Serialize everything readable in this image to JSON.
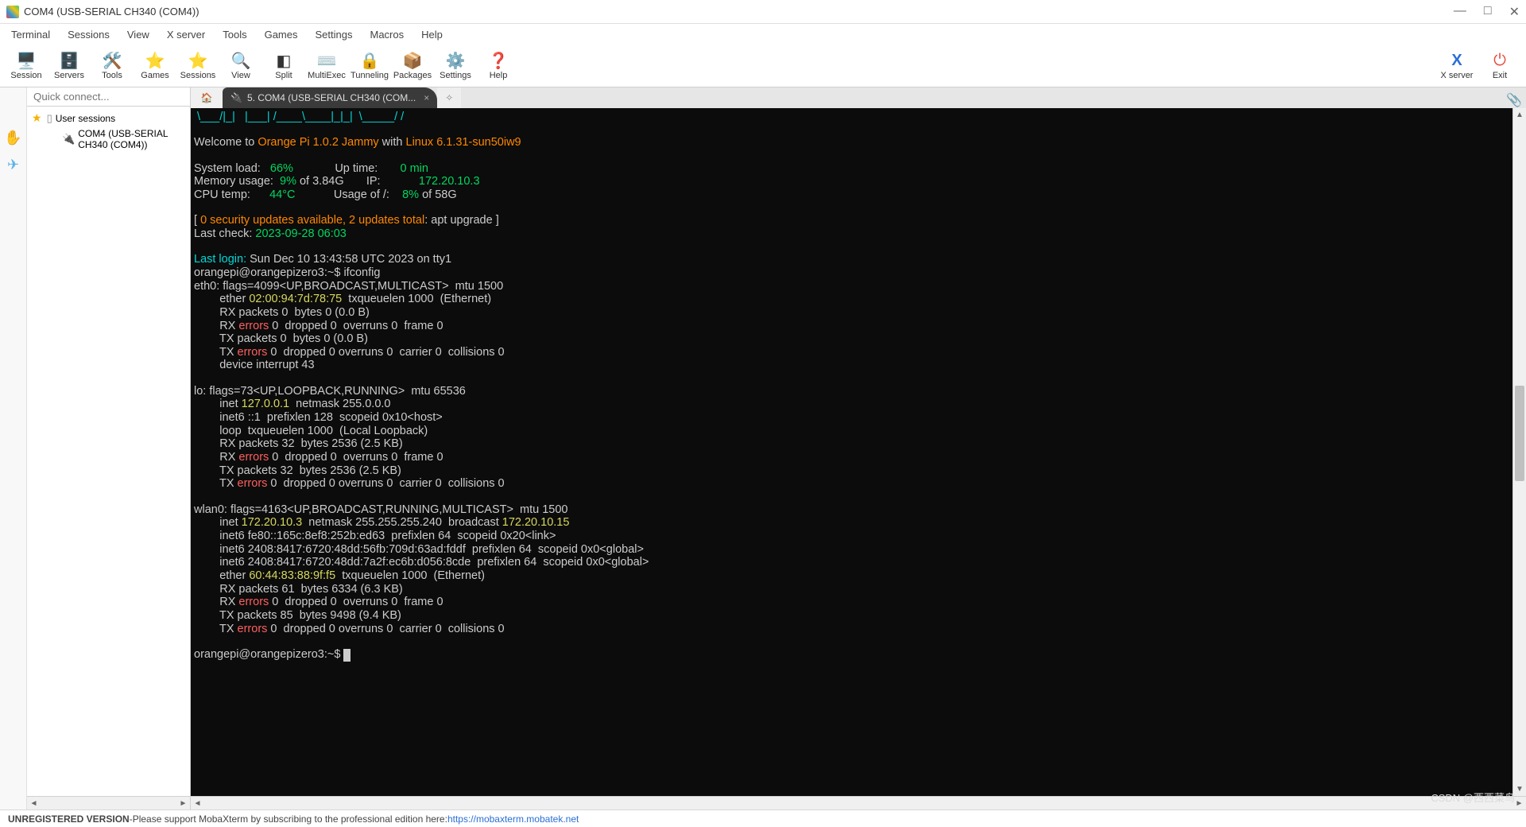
{
  "window": {
    "title": "COM4  (USB-SERIAL CH340 (COM4))",
    "controls": {
      "min": "—",
      "max": "□",
      "close": "✕"
    }
  },
  "menu": {
    "items": [
      "Terminal",
      "Sessions",
      "View",
      "X server",
      "Tools",
      "Games",
      "Settings",
      "Macros",
      "Help"
    ]
  },
  "toolbar": {
    "session": {
      "label": "Session",
      "icon": "🖥️"
    },
    "servers": {
      "label": "Servers",
      "icon": "🗄️"
    },
    "tools": {
      "label": "Tools",
      "icon": "🛠️"
    },
    "games": {
      "label": "Games",
      "icon": "⭐"
    },
    "sessions": {
      "label": "Sessions",
      "icon": "⭐"
    },
    "view": {
      "label": "View",
      "icon": "🔍"
    },
    "split": {
      "label": "Split",
      "icon": "◧"
    },
    "multiexec": {
      "label": "MultiExec",
      "icon": "⌨️"
    },
    "tunneling": {
      "label": "Tunneling",
      "icon": "🔒"
    },
    "packages": {
      "label": "Packages",
      "icon": "📦"
    },
    "settings": {
      "label": "Settings",
      "icon": "⚙️"
    },
    "help": {
      "label": "Help",
      "icon": "❓"
    },
    "xserver": {
      "label": "X server",
      "icon": "X"
    },
    "exit": {
      "label": "Exit",
      "icon": "⏻"
    }
  },
  "sidebar": {
    "quick_placeholder": "Quick connect...",
    "user_sessions": "User sessions",
    "session_item": "COM4  (USB-SERIAL CH340 (COM4))"
  },
  "tabs": {
    "home_icon": "🏠",
    "active_label": "5. COM4  (USB-SERIAL CH340 (COM...",
    "close": "×",
    "add": "✧"
  },
  "terminal": {
    "ascii1": " \\___/|_|   |___| /____\\____|_|_|  \\_____/ /",
    "welcome_pre": "Welcome to ",
    "welcome_os": "Orange Pi 1.0.2 Jammy",
    "welcome_mid": " with ",
    "welcome_kernel": "Linux 6.1.31-sun50iw9",
    "sl_label": "System load:   ",
    "sl_val": "66%",
    "mu_label": "Memory usage:  ",
    "mu_val": "9%",
    "mu_of": " of 3.84G",
    "ct_label": "CPU temp:      ",
    "ct_val": "44°C",
    "ut_label": "Up time:       ",
    "ut_val": "0 min",
    "ip_label": "IP:            ",
    "ip_val": "172.20.10.3",
    "du_label": "Usage of /:    ",
    "du_val": "8%",
    "du_of": " of 58G",
    "upd_lb": "[ ",
    "upd_pre": "0 security updates available, 2 updates total",
    "upd_post": ": apt upgrade ]",
    "lastcheck_l": "Last check: ",
    "lastcheck_v": "2023-09-28 06:03",
    "lastlogin_l": "Last login:",
    "lastlogin_v": " Sun Dec 10 13:43:58 UTC 2023 on tty1",
    "prompt1": "orangepi@orangepizero3:~$ ifconfig",
    "eth0_head": "eth0: flags=4099<UP,BROADCAST,MULTICAST>  mtu 1500",
    "eth0_mac_pre": "        ether ",
    "eth0_mac": "02:00:94:7d:78:75",
    "eth0_mac_post": "  txqueuelen 1000  (Ethernet)",
    "eth0_rx1": "        RX packets 0  bytes 0 (0.0 B)",
    "eth0_rx2_pre": "        RX ",
    "eth0_err": "errors",
    "eth0_rx2_post": " 0  dropped 0  overruns 0  frame 0",
    "eth0_tx1": "        TX packets 0  bytes 0 (0.0 B)",
    "eth0_tx2_pre": "        TX ",
    "eth0_tx2_post": " 0  dropped 0 overruns 0  carrier 0  collisions 0",
    "eth0_int": "        device interrupt 43",
    "lo_head": "lo: flags=73<UP,LOOPBACK,RUNNING>  mtu 65536",
    "lo_inet_pre": "        inet ",
    "lo_inet": "127.0.0.1",
    "lo_inet_post": "  netmask 255.0.0.0",
    "lo_inet6": "        inet6 ::1  prefixlen 128  scopeid 0x10<host>",
    "lo_loop": "        loop  txqueuelen 1000  (Local Loopback)",
    "lo_rx1": "        RX packets 32  bytes 2536 (2.5 KB)",
    "lo_rx2_pre": "        RX ",
    "lo_rx2_post": " 0  dropped 0  overruns 0  frame 0",
    "lo_tx1": "        TX packets 32  bytes 2536 (2.5 KB)",
    "lo_tx2_pre": "        TX ",
    "lo_tx2_post": " 0  dropped 0 overruns 0  carrier 0  collisions 0",
    "wlan_head": "wlan0: flags=4163<UP,BROADCAST,RUNNING,MULTICAST>  mtu 1500",
    "wlan_inet_pre": "        inet ",
    "wlan_inet": "172.20.10.3",
    "wlan_inet_mid": "  netmask 255.255.255.240  broadcast ",
    "wlan_bcast": "172.20.10.15",
    "wlan_inet6a": "        inet6 fe80::165c:8ef8:252b:ed63  prefixlen 64  scopeid 0x20<link>",
    "wlan_inet6b": "        inet6 2408:8417:6720:48dd:56fb:709d:63ad:fddf  prefixlen 64  scopeid 0x0<global>",
    "wlan_inet6c": "        inet6 2408:8417:6720:48dd:7a2f:ec6b:d056:8cde  prefixlen 64  scopeid 0x0<global>",
    "wlan_mac_pre": "        ether ",
    "wlan_mac": "60:44:83:88:9f:f5",
    "wlan_mac_post": "  txqueuelen 1000  (Ethernet)",
    "wlan_rx1": "        RX packets 61  bytes 6334 (6.3 KB)",
    "wlan_rx2_pre": "        RX ",
    "wlan_rx2_post": " 0  dropped 0  overruns 0  frame 0",
    "wlan_tx1": "        TX packets 85  bytes 9498 (9.4 KB)",
    "wlan_tx2_pre": "        TX ",
    "wlan_tx2_post": " 0  dropped 0 overruns 0  carrier 0  collisions 0",
    "prompt2": "orangepi@orangepizero3:~$ "
  },
  "status": {
    "unreg": "UNREGISTERED VERSION",
    "sep": "  -  ",
    "text": "Please support MobaXterm by subscribing to the professional edition here:  ",
    "link": "https://mobaxterm.mobatek.net"
  },
  "watermark": "CSDN @西西菜鸟"
}
